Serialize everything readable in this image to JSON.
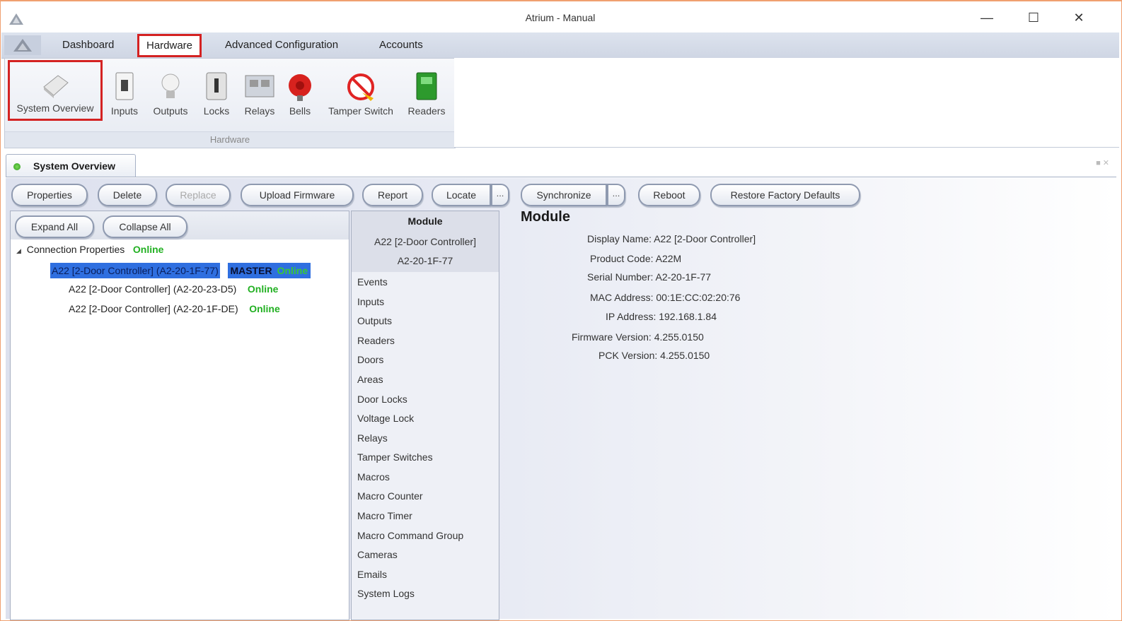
{
  "window": {
    "title": "Atrium - Manual",
    "minimize_icon": "minimize-icon",
    "maximize_icon": "maximize-icon",
    "close_icon": "close-icon"
  },
  "menu_tabs": {
    "dashboard": "Dashboard",
    "hardware": "Hardware",
    "advanced": "Advanced Configuration",
    "accounts": "Accounts"
  },
  "ribbon": {
    "group_label": "Hardware",
    "buttons": [
      "System Overview",
      "Inputs",
      "Outputs",
      "Locks",
      "Relays",
      "Bells",
      "Tamper Switch",
      "Readers"
    ]
  },
  "doc_tab": {
    "label": "System Overview"
  },
  "toolbar": {
    "properties": "Properties",
    "delete": "Delete",
    "replace": "Replace",
    "upload_firmware": "Upload Firmware",
    "report": "Report",
    "locate": "Locate",
    "locate_more": "...",
    "synchronize": "Synchronize",
    "synchronize_more": "...",
    "reboot": "Reboot",
    "restore": "Restore Factory Defaults"
  },
  "tree": {
    "expand_all": "Expand All",
    "collapse_all": "Collapse All",
    "root_label": "Connection Properties",
    "root_status": "Online",
    "nodes": [
      {
        "label": "A22 [2-Door Controller] (A2-20-1F-77)",
        "role": "MASTER",
        "status": "Online"
      },
      {
        "label": "A22 [2-Door Controller] (A2-20-23-D5)",
        "status": "Online"
      },
      {
        "label": "A22 [2-Door Controller] (A2-20-1F-DE)",
        "status": "Online"
      }
    ]
  },
  "module_list": {
    "header": "Module",
    "subtitle_1": "A22 [2-Door Controller]",
    "subtitle_2": "A2-20-1F-77",
    "items": [
      "Events",
      "Inputs",
      "Outputs",
      "Readers",
      "Doors",
      "Areas",
      "Door Locks",
      "Voltage Lock",
      "Relays",
      "Tamper Switches",
      "Macros",
      "Macro Counter",
      "Macro Timer",
      "Macro Command Group",
      "Cameras",
      "Emails",
      "System Logs"
    ]
  },
  "details": {
    "title": "Module",
    "display_name": "Display Name: A22 [2-Door Controller]",
    "product_code": "Product Code: A22M",
    "serial": "Serial Number: A2-20-1F-77",
    "mac": "MAC Address: 00:1E:CC:02:20:76",
    "ip": "IP Address: 192.168.1.84",
    "firmware": "Firmware Version: 4.255.0150",
    "pck": "PCK Version: 4.255.0150"
  }
}
